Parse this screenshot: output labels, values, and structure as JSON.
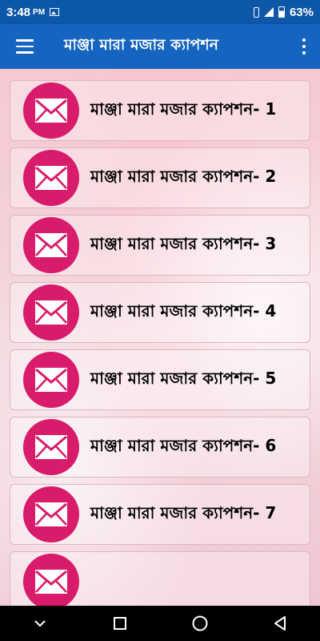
{
  "status_bar": {
    "time": "3:48",
    "ampm": "PM",
    "battery": "63%",
    "icons": [
      "photo-icon",
      "vibrate-icon",
      "signal-icon",
      "battery-icon"
    ]
  },
  "app_bar": {
    "title": "মাঞ্জা মারা মজার ক্যাপশন",
    "menu_icon": "hamburger-icon",
    "overflow_icon": "more-vert-icon",
    "color": "#1565c0"
  },
  "list": {
    "icon": "envelope-icon",
    "icon_color": "#d81b6a",
    "items": [
      {
        "label": "মাঞ্জা মারা মজার ক্যাপশন- 1"
      },
      {
        "label": "মাঞ্জা মারা মজার ক্যাপশন- 2"
      },
      {
        "label": "মাঞ্জা মারা মজার ক্যাপশন- 3"
      },
      {
        "label": "মাঞ্জা মারা মজার ক্যাপশন- 4"
      },
      {
        "label": "মাঞ্জা মারা মজার ক্যাপশন- 5"
      },
      {
        "label": "মাঞ্জা মারা মজার ক্যাপশন- 6"
      },
      {
        "label": "মাঞ্জা মারা মজার ক্যাপশন- 7"
      },
      {
        "label": ""
      }
    ]
  },
  "nav_bar": {
    "buttons": [
      "chevron-down-icon",
      "recents-square-icon",
      "home-circle-icon",
      "back-triangle-icon"
    ]
  }
}
